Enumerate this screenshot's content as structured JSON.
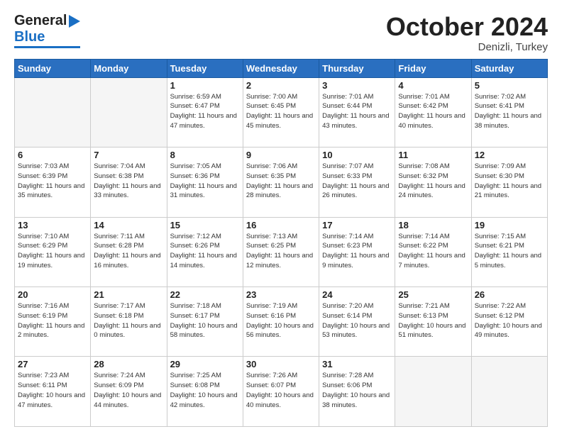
{
  "header": {
    "logo_general": "General",
    "logo_blue": "Blue",
    "month_title": "October 2024",
    "location": "Denizli, Turkey"
  },
  "days_of_week": [
    "Sunday",
    "Monday",
    "Tuesday",
    "Wednesday",
    "Thursday",
    "Friday",
    "Saturday"
  ],
  "weeks": [
    [
      {
        "day": "",
        "info": ""
      },
      {
        "day": "",
        "info": ""
      },
      {
        "day": "1",
        "info": "Sunrise: 6:59 AM\nSunset: 6:47 PM\nDaylight: 11 hours and 47 minutes."
      },
      {
        "day": "2",
        "info": "Sunrise: 7:00 AM\nSunset: 6:45 PM\nDaylight: 11 hours and 45 minutes."
      },
      {
        "day": "3",
        "info": "Sunrise: 7:01 AM\nSunset: 6:44 PM\nDaylight: 11 hours and 43 minutes."
      },
      {
        "day": "4",
        "info": "Sunrise: 7:01 AM\nSunset: 6:42 PM\nDaylight: 11 hours and 40 minutes."
      },
      {
        "day": "5",
        "info": "Sunrise: 7:02 AM\nSunset: 6:41 PM\nDaylight: 11 hours and 38 minutes."
      }
    ],
    [
      {
        "day": "6",
        "info": "Sunrise: 7:03 AM\nSunset: 6:39 PM\nDaylight: 11 hours and 35 minutes."
      },
      {
        "day": "7",
        "info": "Sunrise: 7:04 AM\nSunset: 6:38 PM\nDaylight: 11 hours and 33 minutes."
      },
      {
        "day": "8",
        "info": "Sunrise: 7:05 AM\nSunset: 6:36 PM\nDaylight: 11 hours and 31 minutes."
      },
      {
        "day": "9",
        "info": "Sunrise: 7:06 AM\nSunset: 6:35 PM\nDaylight: 11 hours and 28 minutes."
      },
      {
        "day": "10",
        "info": "Sunrise: 7:07 AM\nSunset: 6:33 PM\nDaylight: 11 hours and 26 minutes."
      },
      {
        "day": "11",
        "info": "Sunrise: 7:08 AM\nSunset: 6:32 PM\nDaylight: 11 hours and 24 minutes."
      },
      {
        "day": "12",
        "info": "Sunrise: 7:09 AM\nSunset: 6:30 PM\nDaylight: 11 hours and 21 minutes."
      }
    ],
    [
      {
        "day": "13",
        "info": "Sunrise: 7:10 AM\nSunset: 6:29 PM\nDaylight: 11 hours and 19 minutes."
      },
      {
        "day": "14",
        "info": "Sunrise: 7:11 AM\nSunset: 6:28 PM\nDaylight: 11 hours and 16 minutes."
      },
      {
        "day": "15",
        "info": "Sunrise: 7:12 AM\nSunset: 6:26 PM\nDaylight: 11 hours and 14 minutes."
      },
      {
        "day": "16",
        "info": "Sunrise: 7:13 AM\nSunset: 6:25 PM\nDaylight: 11 hours and 12 minutes."
      },
      {
        "day": "17",
        "info": "Sunrise: 7:14 AM\nSunset: 6:23 PM\nDaylight: 11 hours and 9 minutes."
      },
      {
        "day": "18",
        "info": "Sunrise: 7:14 AM\nSunset: 6:22 PM\nDaylight: 11 hours and 7 minutes."
      },
      {
        "day": "19",
        "info": "Sunrise: 7:15 AM\nSunset: 6:21 PM\nDaylight: 11 hours and 5 minutes."
      }
    ],
    [
      {
        "day": "20",
        "info": "Sunrise: 7:16 AM\nSunset: 6:19 PM\nDaylight: 11 hours and 2 minutes."
      },
      {
        "day": "21",
        "info": "Sunrise: 7:17 AM\nSunset: 6:18 PM\nDaylight: 11 hours and 0 minutes."
      },
      {
        "day": "22",
        "info": "Sunrise: 7:18 AM\nSunset: 6:17 PM\nDaylight: 10 hours and 58 minutes."
      },
      {
        "day": "23",
        "info": "Sunrise: 7:19 AM\nSunset: 6:16 PM\nDaylight: 10 hours and 56 minutes."
      },
      {
        "day": "24",
        "info": "Sunrise: 7:20 AM\nSunset: 6:14 PM\nDaylight: 10 hours and 53 minutes."
      },
      {
        "day": "25",
        "info": "Sunrise: 7:21 AM\nSunset: 6:13 PM\nDaylight: 10 hours and 51 minutes."
      },
      {
        "day": "26",
        "info": "Sunrise: 7:22 AM\nSunset: 6:12 PM\nDaylight: 10 hours and 49 minutes."
      }
    ],
    [
      {
        "day": "27",
        "info": "Sunrise: 7:23 AM\nSunset: 6:11 PM\nDaylight: 10 hours and 47 minutes."
      },
      {
        "day": "28",
        "info": "Sunrise: 7:24 AM\nSunset: 6:09 PM\nDaylight: 10 hours and 44 minutes."
      },
      {
        "day": "29",
        "info": "Sunrise: 7:25 AM\nSunset: 6:08 PM\nDaylight: 10 hours and 42 minutes."
      },
      {
        "day": "30",
        "info": "Sunrise: 7:26 AM\nSunset: 6:07 PM\nDaylight: 10 hours and 40 minutes."
      },
      {
        "day": "31",
        "info": "Sunrise: 7:28 AM\nSunset: 6:06 PM\nDaylight: 10 hours and 38 minutes."
      },
      {
        "day": "",
        "info": ""
      },
      {
        "day": "",
        "info": ""
      }
    ]
  ]
}
